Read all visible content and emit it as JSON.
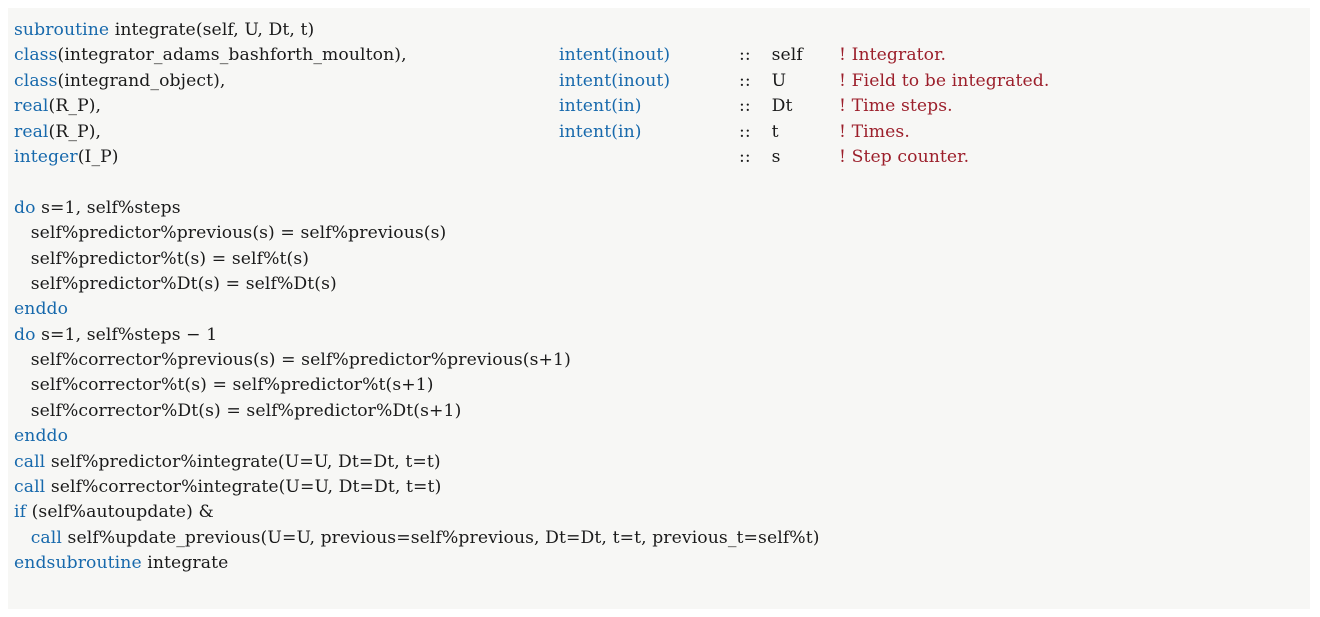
{
  "listing": {
    "language": "fortran",
    "background_color": "#f7f7f5",
    "keyword_color": "#1769ac",
    "comment_color": "#9c1f2b",
    "text_color": "#1a1a1a",
    "lines": [
      {
        "id": "line-1",
        "kind": "signature",
        "keyword": "subroutine",
        "text": " integrate(self, U, Dt, t)"
      },
      {
        "id": "line-2",
        "kind": "declaration",
        "keyword": "class",
        "type_rest": "(integrator_adams_bashforth_moulton),",
        "intent_kw": "intent",
        "intent_rest": "(inout)",
        "dcolon": "::",
        "var": "self",
        "comment": "! Integrator."
      },
      {
        "id": "line-3",
        "kind": "declaration",
        "keyword": "class",
        "type_rest": "(integrand_object),",
        "intent_kw": "intent",
        "intent_rest": "(inout)",
        "dcolon": "::",
        "var": "U",
        "comment": "! Field to be integrated."
      },
      {
        "id": "line-4",
        "kind": "declaration",
        "keyword": "real",
        "type_rest": "(R_P),",
        "intent_kw": "intent",
        "intent_rest": "(in)",
        "dcolon": "::",
        "var": "Dt",
        "comment": "! Time steps."
      },
      {
        "id": "line-5",
        "kind": "declaration",
        "keyword": "real",
        "type_rest": "(R_P),",
        "intent_kw": "intent",
        "intent_rest": "(in)",
        "dcolon": "::",
        "var": "t",
        "comment": "! Times."
      },
      {
        "id": "line-6",
        "kind": "declaration",
        "keyword": "integer",
        "type_rest": "(I_P)",
        "intent_kw": "",
        "intent_rest": "",
        "dcolon": "::",
        "var": "s",
        "comment": "! Step counter."
      },
      {
        "id": "line-7",
        "kind": "blank"
      },
      {
        "id": "line-8",
        "kind": "statement",
        "keyword": "do",
        "text": " s=1, self%steps"
      },
      {
        "id": "line-9",
        "kind": "plain",
        "text": "   self%predictor%previous(s) = self%previous(s)"
      },
      {
        "id": "line-10",
        "kind": "plain",
        "text": "   self%predictor%t(s) = self%t(s)"
      },
      {
        "id": "line-11",
        "kind": "plain",
        "text": "   self%predictor%Dt(s) = self%Dt(s)"
      },
      {
        "id": "line-12",
        "kind": "statement",
        "keyword": "enddo",
        "text": ""
      },
      {
        "id": "line-13",
        "kind": "statement",
        "keyword": "do",
        "text": " s=1, self%steps − 1"
      },
      {
        "id": "line-14",
        "kind": "plain",
        "text": "   self%corrector%previous(s) = self%predictor%previous(s+1)"
      },
      {
        "id": "line-15",
        "kind": "plain",
        "text": "   self%corrector%t(s) = self%predictor%t(s+1)"
      },
      {
        "id": "line-16",
        "kind": "plain",
        "text": "   self%corrector%Dt(s) = self%predictor%Dt(s+1)"
      },
      {
        "id": "line-17",
        "kind": "statement",
        "keyword": "enddo",
        "text": ""
      },
      {
        "id": "line-18",
        "kind": "statement",
        "keyword": "call",
        "text": " self%predictor%integrate(U=U, Dt=Dt, t=t)"
      },
      {
        "id": "line-19",
        "kind": "statement",
        "keyword": "call",
        "text": " self%corrector%integrate(U=U, Dt=Dt, t=t)"
      },
      {
        "id": "line-20",
        "kind": "statement",
        "keyword": "if",
        "text": " (self%autoupdate) &"
      },
      {
        "id": "line-21",
        "kind": "statement-indented",
        "indent": "   ",
        "keyword": "call",
        "text": " self%update_previous(U=U, previous=self%previous, Dt=Dt, t=t, previous_t=self%t)"
      },
      {
        "id": "line-22",
        "kind": "statement",
        "keyword": "endsubroutine",
        "text": " integrate"
      }
    ]
  }
}
